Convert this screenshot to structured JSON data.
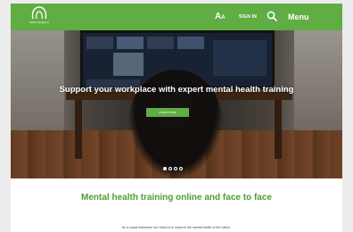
{
  "header": {
    "logo_text": "MHFA England",
    "text_size_large": "A",
    "text_size_small": "A",
    "signin_label": "SIGN IN",
    "search_icon": "search-icon",
    "menu_label": "Menu",
    "background_color": "#5fad43"
  },
  "hero": {
    "heading": "Support your workplace with expert mental health training",
    "cta_label": "Learn more",
    "carousel_active_index": 0,
    "carousel_count": 4
  },
  "main": {
    "heading": "Mental health training online and face to face",
    "mission_text": "As a social enterprise our vision is to improve the mental health of the nation."
  },
  "colors": {
    "brand_green": "#5fad43",
    "heading_green": "#4e9e35"
  }
}
